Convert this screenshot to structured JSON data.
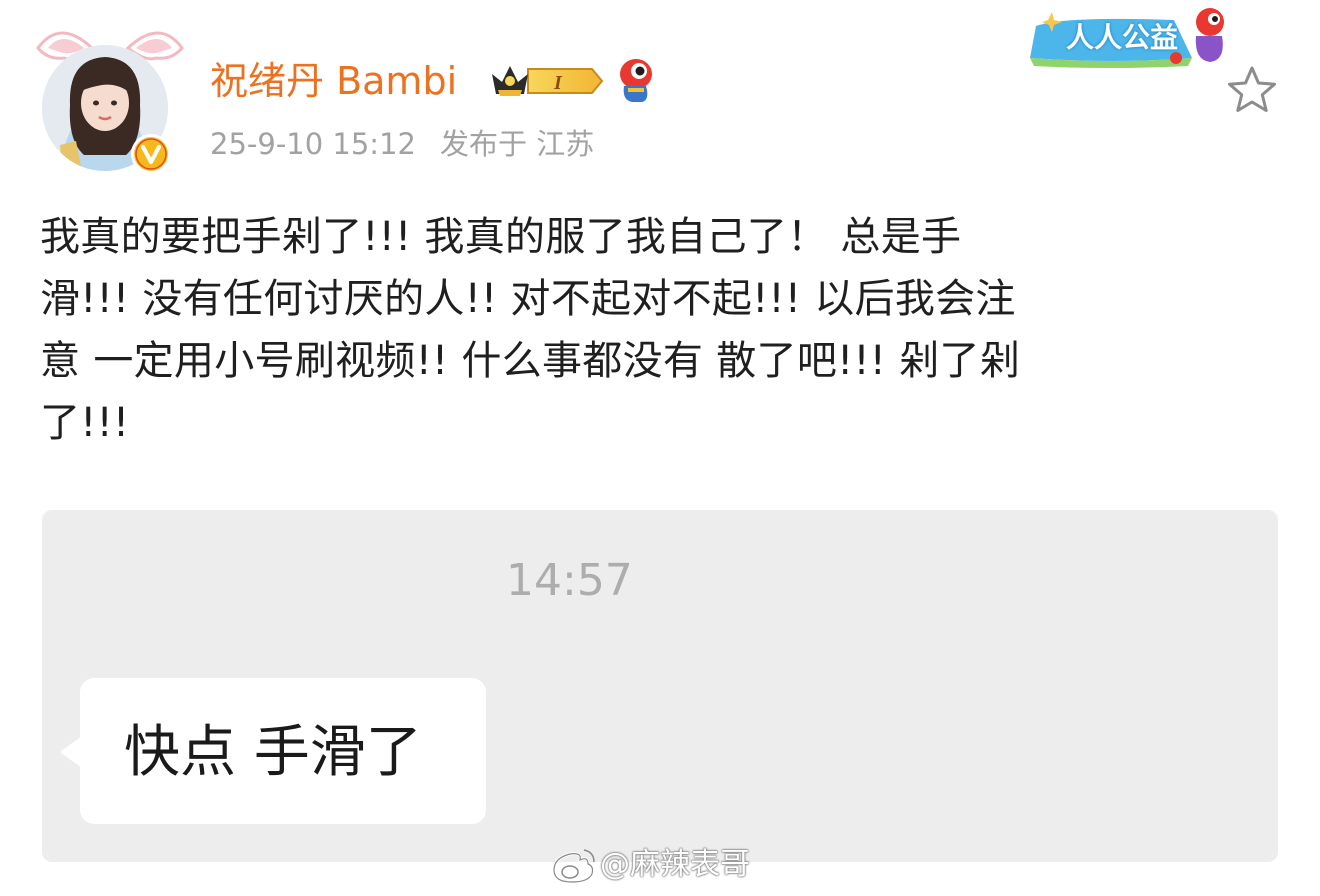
{
  "post": {
    "author": "祝绪丹 Bambi",
    "level_badge": "I",
    "time": "25-9-10 15:12",
    "location": "发布于 江苏",
    "charity_label": "人人公益",
    "text_lines": [
      "我真的要把手剁了!!! 我真的服了我自己了！ 总是手",
      "滑!!! 没有任何讨厌的人!! 对不起对不起!!! 以后我会注",
      "意 一定用小号刷视频!! 什么事都没有 散了吧!!! 剁了剁",
      "了!!!"
    ]
  },
  "chat_screenshot": {
    "time": "14:57",
    "message": "快点 手滑了"
  },
  "watermark": {
    "text": "@麻辣表哥"
  },
  "colors": {
    "username": "#eb7220",
    "meta": "#a2a2a2",
    "card_bg": "#ededed",
    "verified_badge": "#f7c62f"
  },
  "icons": [
    "bunny-ears-icon",
    "verified-v-icon",
    "crown-badge-icon",
    "mascot-icon",
    "charity-banner-icon",
    "star-icon",
    "weibo-logo-icon"
  ]
}
